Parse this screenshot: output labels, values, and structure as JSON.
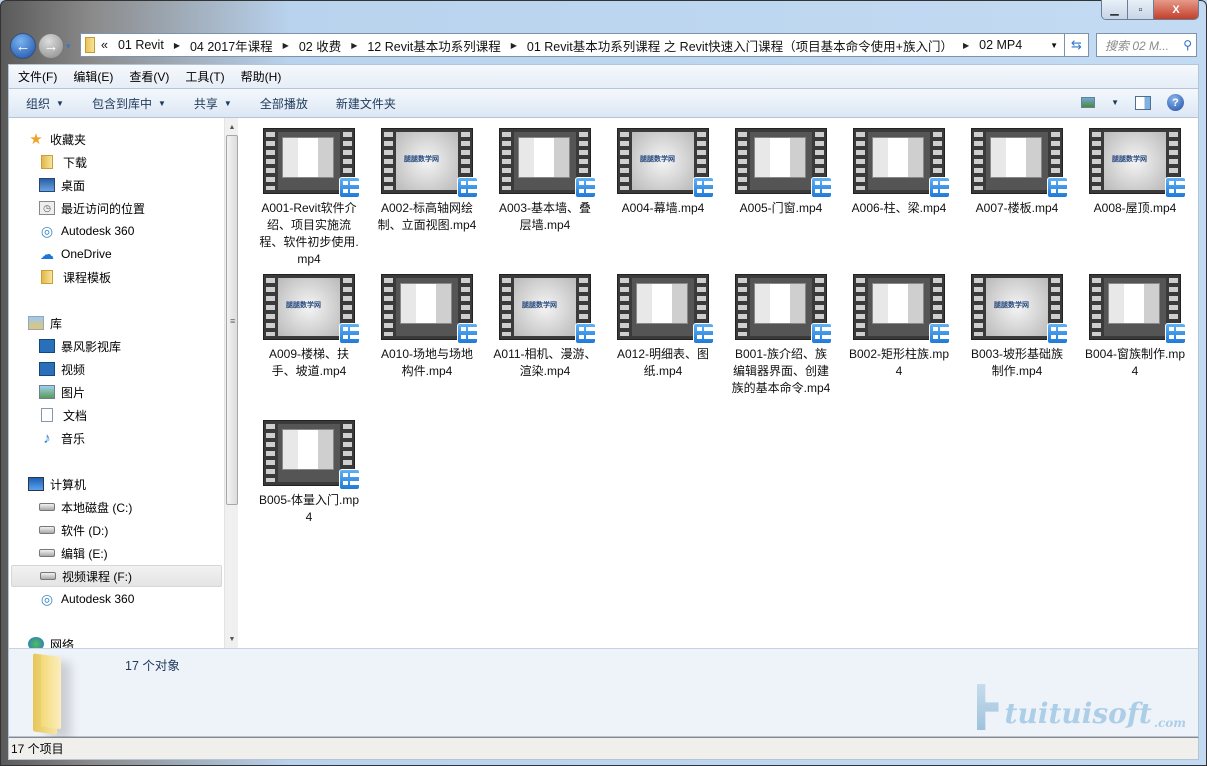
{
  "window": {
    "min_icon": "minimize-icon",
    "max_icon": "maximize-icon",
    "close_label": "X"
  },
  "nav": {
    "back_icon": "back-arrow-icon",
    "forward_icon": "forward-arrow-icon",
    "dropdown": "▾"
  },
  "address": {
    "overflow": "«",
    "crumbs": [
      "01 Revit",
      "04 2017年课程",
      "02 收费",
      "12 Revit基本功系列课程",
      "01 Revit基本功系列课程 之 Revit快速入门课程（项目基本命令使用+族入门）",
      "02 MP4"
    ]
  },
  "search": {
    "placeholder": "搜索 02 M..."
  },
  "menu": [
    "文件(F)",
    "编辑(E)",
    "查看(V)",
    "工具(T)",
    "帮助(H)"
  ],
  "commands": {
    "organize": "组织",
    "include_library": "包含到库中",
    "share": "共享",
    "play_all": "全部播放",
    "new_folder": "新建文件夹",
    "help": "?"
  },
  "sidebar": {
    "favorites": {
      "label": "收藏夹",
      "items": [
        "下载",
        "桌面",
        "最近访问的位置",
        "Autodesk 360",
        "OneDrive",
        "课程模板"
      ]
    },
    "libraries": {
      "label": "库",
      "items": [
        "暴风影视库",
        "视频",
        "图片",
        "文档",
        "音乐"
      ]
    },
    "computer": {
      "label": "计算机",
      "items": [
        "本地磁盘 (C:)",
        "软件 (D:)",
        "编辑 (E:)",
        "视频课程 (F:)",
        "Autodesk 360"
      ],
      "selected": "视频课程 (F:)"
    },
    "network": {
      "label": "网络"
    }
  },
  "thumbnail_logo_text": "腿腿数学网",
  "files": [
    {
      "name": "A001-Revit软件介绍、项目实施流程、软件初步使用.mp4",
      "thumb": "screen"
    },
    {
      "name": "A002-标高轴网绘制、立面视图.mp4",
      "thumb": "logo"
    },
    {
      "name": "A003-基本墙、叠层墙.mp4",
      "thumb": "screen"
    },
    {
      "name": "A004-幕墙.mp4",
      "thumb": "logo"
    },
    {
      "name": "A005-门窗.mp4",
      "thumb": "screen"
    },
    {
      "name": "A006-柱、梁.mp4",
      "thumb": "screen"
    },
    {
      "name": "A007-楼板.mp4",
      "thumb": "screen"
    },
    {
      "name": "A008-屋顶.mp4",
      "thumb": "logo"
    },
    {
      "name": "A009-楼梯、扶手、坡道.mp4",
      "thumb": "logo"
    },
    {
      "name": "A010-场地与场地构件.mp4",
      "thumb": "screen"
    },
    {
      "name": "A011-相机、漫游、渲染.mp4",
      "thumb": "logo"
    },
    {
      "name": "A012-明细表、图纸.mp4",
      "thumb": "screen"
    },
    {
      "name": "B001-族介绍、族编辑器界面、创建族的基本命令.mp4",
      "thumb": "screen"
    },
    {
      "name": "B002-矩形柱族.mp4",
      "thumb": "screen"
    },
    {
      "name": "B003-坡形基础族制作.mp4",
      "thumb": "logo"
    },
    {
      "name": "B004-窗族制作.mp4",
      "thumb": "screen"
    },
    {
      "name": "B005-体量入门.mp4",
      "thumb": "screen"
    }
  ],
  "details": {
    "count": "17 个对象"
  },
  "status": {
    "items": "17 个项目"
  },
  "watermark": {
    "text": "tuituisoft",
    "suffix": ".com"
  }
}
